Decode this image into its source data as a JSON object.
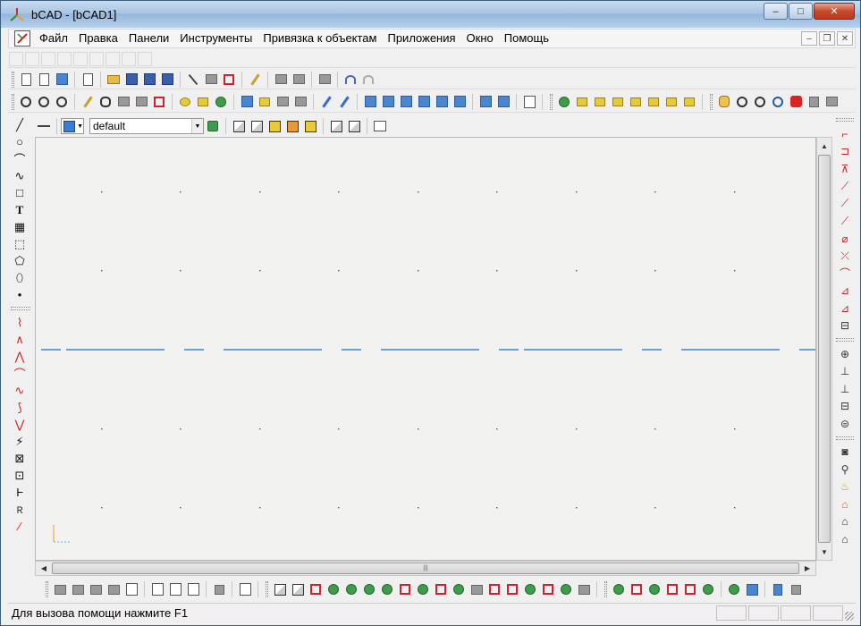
{
  "window": {
    "title": "bCAD - [bCAD1]",
    "minimize_glyph": "–",
    "maximize_glyph": "□",
    "close_glyph": "✕"
  },
  "menu": {
    "items": [
      "Файл",
      "Правка",
      "Панели",
      "Инструменты",
      "Привязка к объектам",
      "Приложения",
      "Окно",
      "Помощь"
    ],
    "mdi_minimize": "–",
    "mdi_restore": "❐",
    "mdi_close": "✕"
  },
  "properties": {
    "layer_value": "default",
    "color": "#3a7cd0"
  },
  "left_tools": {
    "line": "╱",
    "circle": "○",
    "arc": "⌒",
    "spline": "∿",
    "rectangle": "□",
    "text": "T",
    "hatch": "▦",
    "block": "⬚",
    "polygon": "⬠",
    "ellipse": "⬯",
    "point": "•",
    "edit_tools": [
      "⌇",
      "∧",
      "⋀",
      "⌒",
      "∿",
      "⟆",
      "⋁",
      "⚡",
      "⊠",
      "⊡",
      "Ⱶ",
      "Ｒ",
      "⁄"
    ]
  },
  "right_tools": [
    "⌐",
    "⊐",
    "⊼",
    "⟋",
    "⟋",
    "⟋",
    "⌀",
    "⤫",
    "⌒",
    "⊿",
    "⊿",
    "⊟",
    "⊕",
    "⊥",
    "⊥",
    "⊟",
    "⊜",
    "◙",
    "⚲",
    "♨",
    "⌂",
    "⌂",
    "⌂"
  ],
  "canvas": {
    "background": "#f2f3f1",
    "guide_color": "#3a86d8"
  },
  "status": {
    "help_text": "Для вызова помощи нажмите F1"
  }
}
